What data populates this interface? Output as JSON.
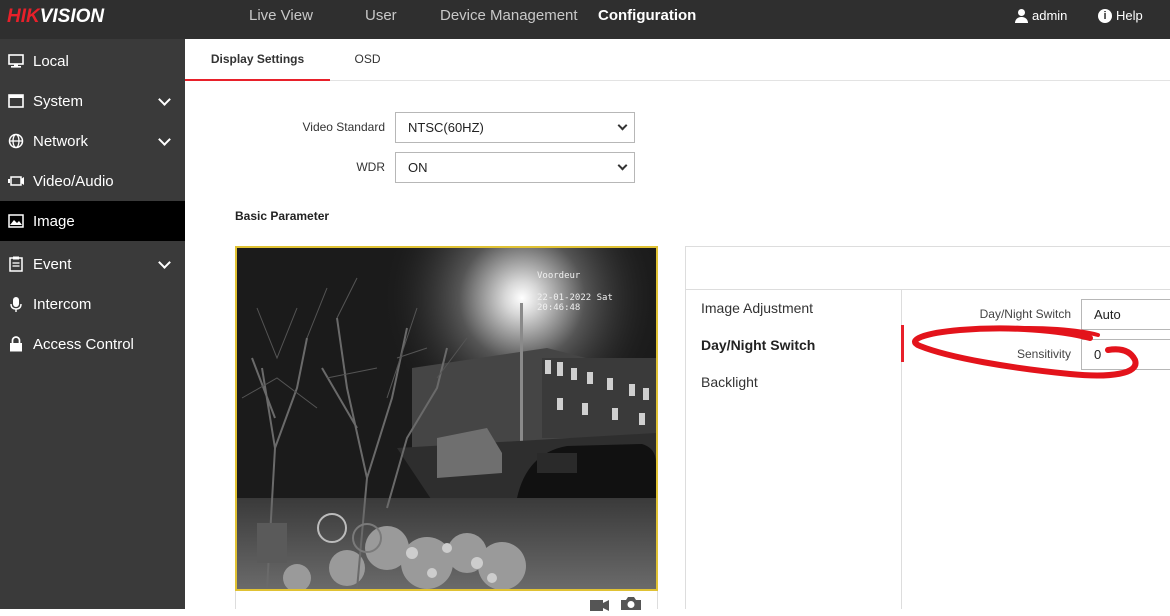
{
  "header": {
    "logo_hik": "HIK",
    "logo_rest": "VISION",
    "nav": [
      {
        "label": "Live View",
        "active": false
      },
      {
        "label": "User",
        "active": false
      },
      {
        "label": "Device Management",
        "active": false
      },
      {
        "label": "Configuration",
        "active": true
      }
    ],
    "user_label": "admin",
    "help_label": "Help"
  },
  "sidebar": {
    "items": [
      {
        "label": "Local",
        "icon": "monitor-icon"
      },
      {
        "label": "System",
        "icon": "system-icon"
      },
      {
        "label": "Network",
        "icon": "globe-icon"
      },
      {
        "label": "Video/Audio",
        "icon": "camera-icon"
      },
      {
        "label": "Image",
        "icon": "image-icon"
      },
      {
        "label": "Event",
        "icon": "clipboard-icon"
      },
      {
        "label": "Intercom",
        "icon": "microphone-icon"
      },
      {
        "label": "Access Control",
        "icon": "lock-icon"
      }
    ],
    "active": "Image"
  },
  "tabs": [
    {
      "label": "Display Settings",
      "active": true
    },
    {
      "label": "OSD",
      "active": false
    }
  ],
  "form": {
    "video_standard_label": "Video Standard",
    "video_standard_value": "NTSC(60HZ)",
    "wdr_label": "WDR",
    "wdr_value": "ON"
  },
  "basic_parameter": {
    "title": "Basic Parameter",
    "osd_name": "Voordeur",
    "osd_time": "22-01-2022 Sat 20:46:48"
  },
  "panel": {
    "menu": [
      {
        "label": "Image Adjustment",
        "active": false
      },
      {
        "label": "Day/Night Switch",
        "active": true
      },
      {
        "label": "Backlight",
        "active": false
      }
    ],
    "day_night_label": "Day/Night Switch",
    "day_night_value": "Auto",
    "sensitivity_label": "Sensitivity",
    "sensitivity_value": "0"
  },
  "colors": {
    "topbar": "#2f2f2f",
    "sidebar": "#3a3a3a",
    "accent": "#e8202a",
    "preview_border": "#e0c234",
    "annotation": "#e3131b"
  }
}
